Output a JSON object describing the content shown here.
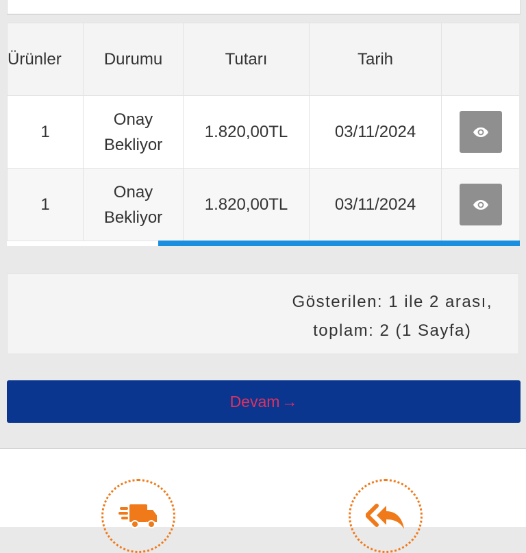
{
  "table": {
    "headers": {
      "products": "Ürünler",
      "status": "Durumu",
      "amount": "Tutarı",
      "date": "Tarih",
      "action": ""
    },
    "rows": [
      {
        "products": "1",
        "status_line1": "Onay",
        "status_line2": "Bekliyor",
        "amount": "1.820,00TL",
        "date": "03/11/2024",
        "action_icon": "eye-icon"
      },
      {
        "products": "1",
        "status_line1": "Onay",
        "status_line2": "Bekliyor",
        "amount": "1.820,00TL",
        "date": "03/11/2024",
        "action_icon": "eye-icon"
      }
    ]
  },
  "pagination": {
    "line1": "Gösterilen: 1 ile 2 arası,",
    "line2": "toplam: 2 (1 Sayfa)"
  },
  "continue_button": {
    "label": "Devam",
    "arrow": "→"
  },
  "bottom_nav": [
    {
      "icon": "delivery-truck-icon"
    },
    {
      "icon": "reply-all-icon"
    }
  ],
  "colors": {
    "primary_button": "#0a3690",
    "button_text": "#e0315f",
    "scroll_indicator": "#1a8fe0",
    "nav_accent": "#f07a1a",
    "action_button": "#8f8f8f"
  }
}
